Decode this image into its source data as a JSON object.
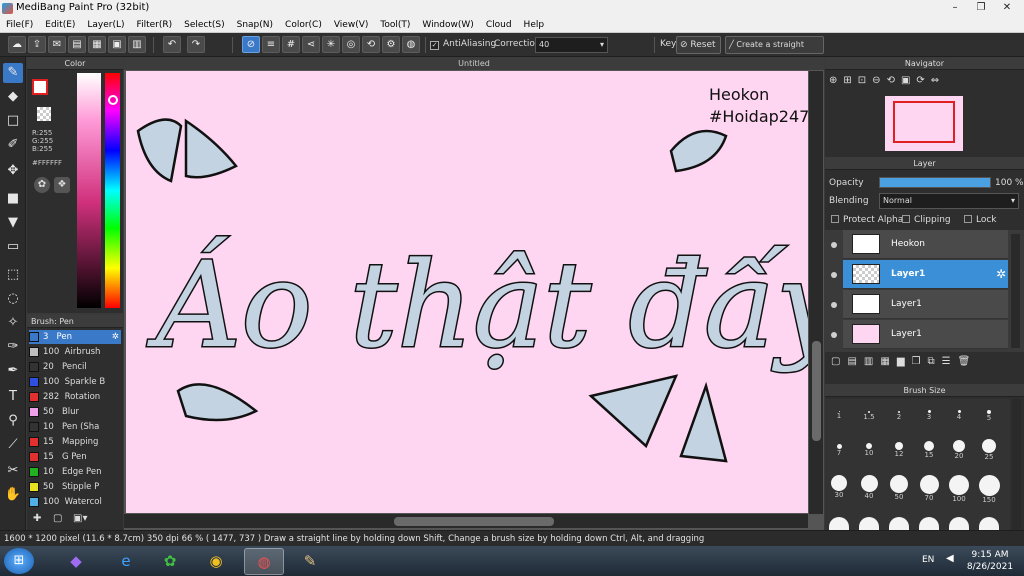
{
  "window": {
    "title": "MediBang Paint Pro (32bit)"
  },
  "menu": [
    "File(F)",
    "Edit(E)",
    "Layer(L)",
    "Filter(R)",
    "Select(S)",
    "Snap(N)",
    "Color(C)",
    "View(V)",
    "Tool(T)",
    "Window(W)",
    "Cloud",
    "Help"
  ],
  "toolbar": {
    "antialiasing_label": "AntiAliasing",
    "correction_label": "Correction",
    "correction_value": "40",
    "key_label": "Key",
    "reset_label": "Reset",
    "straight_line_label": "Create a straight line"
  },
  "color_panel": {
    "title": "Color",
    "r": "R:255",
    "g": "G:255",
    "b": "B:255",
    "hex": "#FFFFFF"
  },
  "brush_panel": {
    "title": "Brush: Pen",
    "items": [
      {
        "size": "3",
        "name": "Pen",
        "color": "#3a78c8"
      },
      {
        "size": "100",
        "name": "Airbrush",
        "color": "#bdbdbd"
      },
      {
        "size": "20",
        "name": "Pencil",
        "color": "#333333"
      },
      {
        "size": "100",
        "name": "Sparkle B",
        "color": "#2f4fe0"
      },
      {
        "size": "282",
        "name": "Rotation",
        "color": "#e03030"
      },
      {
        "size": "50",
        "name": "Blur",
        "color": "#f0a0e8"
      },
      {
        "size": "10",
        "name": "Pen (Sha",
        "color": "#333333"
      },
      {
        "size": "15",
        "name": "Mapping",
        "color": "#e03030"
      },
      {
        "size": "15",
        "name": "G Pen",
        "color": "#e03030"
      },
      {
        "size": "10",
        "name": "Edge Pen",
        "color": "#20b020"
      },
      {
        "size": "50",
        "name": "Stipple P",
        "color": "#e8e020"
      },
      {
        "size": "100",
        "name": "Watercol",
        "color": "#50b0e8"
      }
    ]
  },
  "canvas": {
    "tab_title": "Untitled",
    "lettering": "Áo thật đấy",
    "watermark_line1": "Heokon",
    "watermark_line2": "#Hoidap247"
  },
  "navigator": {
    "title": "Navigator"
  },
  "layer_panel": {
    "title": "Layer",
    "opacity_label": "Opacity",
    "opacity_value": "100 %",
    "opacity": 1.0,
    "blending_label": "Blending",
    "blending_value": "Normal",
    "protect_alpha": "Protect Alpha",
    "clipping": "Clipping",
    "lock": "Lock",
    "layers": [
      {
        "name": "Heokon",
        "selected": false
      },
      {
        "name": "Layer1",
        "selected": true
      },
      {
        "name": "Layer1",
        "selected": false
      },
      {
        "name": "Layer1",
        "selected": false
      }
    ]
  },
  "brush_size_panel": {
    "title": "Brush Size",
    "sizes": [
      "1",
      "1.5",
      "2",
      "3",
      "4",
      "5",
      "7",
      "10",
      "12",
      "15",
      "20",
      "25",
      "30",
      "40",
      "50",
      "70",
      "100",
      "150"
    ]
  },
  "status": {
    "text": "1600 * 1200 pixel   (11.6 * 8.7cm)   350 dpi   66 %   ( 1477, 737 )   Draw a straight line by holding down Shift, Change a brush size by holding down Ctrl, Alt, and dragging"
  },
  "taskbar": {
    "lang": "EN",
    "time": "9:15 AM",
    "date": "8/26/2021"
  },
  "colors": {
    "canvas_bg": "#ffd6f2",
    "letter_fill": "#c4d3e2",
    "accent": "#3a8fd6"
  }
}
